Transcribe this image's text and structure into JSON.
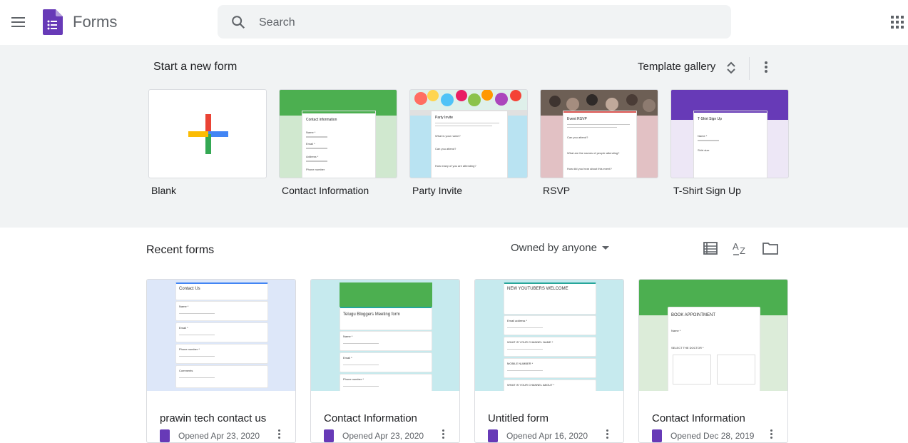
{
  "app": {
    "name": "Forms"
  },
  "search": {
    "placeholder": "Search"
  },
  "start_section": {
    "title": "Start a new form",
    "template_gallery_label": "Template gallery",
    "templates": [
      {
        "label": "Blank"
      },
      {
        "label": "Contact Information",
        "preview_title": "Contact information",
        "preview_fields": [
          "Name *",
          "Email *",
          "Address *",
          "Phone number"
        ]
      },
      {
        "label": "Party Invite",
        "preview_title": "Party Invite",
        "preview_fields": [
          "What is your name?",
          "Can you attend?",
          "How many of you are attending?"
        ]
      },
      {
        "label": "RSVP",
        "preview_title": "Event RSVP",
        "preview_fields": [
          "Can you attend?",
          "What are the names of people attending?",
          "How did you hear about this event?"
        ]
      },
      {
        "label": "T-Shirt Sign Up",
        "preview_title": "T-Shirt Sign Up",
        "preview_fields": [
          "Name *",
          "Shirt size"
        ]
      }
    ]
  },
  "recent": {
    "title": "Recent forms",
    "owner_filter": "Owned by anyone",
    "forms": [
      {
        "title": "prawin tech contact us",
        "meta": "Opened Apr 23, 2020",
        "preview_title": "Contact Us",
        "preview_fields": [
          "Name *",
          "Email *",
          "Phone number *",
          "Comments"
        ]
      },
      {
        "title": "Contact Information",
        "meta": "Opened Apr 23, 2020",
        "preview_title": "Telugu Bloggers Meeting form",
        "preview_fields": [
          "Name *",
          "Email *",
          "Phone number *"
        ]
      },
      {
        "title": "Untitled form",
        "meta": "Opened Apr 16, 2020",
        "preview_title": "NEW YOUTUBERS WELCOME",
        "preview_fields": [
          "Email address *",
          "WHAT IS YOUR CHANNEL NAME *",
          "MOBILE NUMBER *",
          "WHAT IS YOUR CHANNEL ABOUT *"
        ]
      },
      {
        "title": "Contact Information",
        "meta": "Opened Dec 28, 2019",
        "preview_title": "BOOK APPOINTMENT",
        "preview_fields": [
          "Name *",
          "SELECT THE DOCTOR *"
        ]
      }
    ]
  },
  "colors": {
    "brand": "#673ab7",
    "green": "#4caf50",
    "blue": "#4285f4",
    "red": "#ea4335",
    "yellow": "#fbbc04"
  },
  "icons": [
    "menu-icon",
    "forms-logo-icon",
    "search-icon",
    "apps-grid-icon",
    "unfold-icon",
    "more-vert-icon",
    "list-view-icon",
    "sort-az-icon",
    "folder-icon"
  ]
}
